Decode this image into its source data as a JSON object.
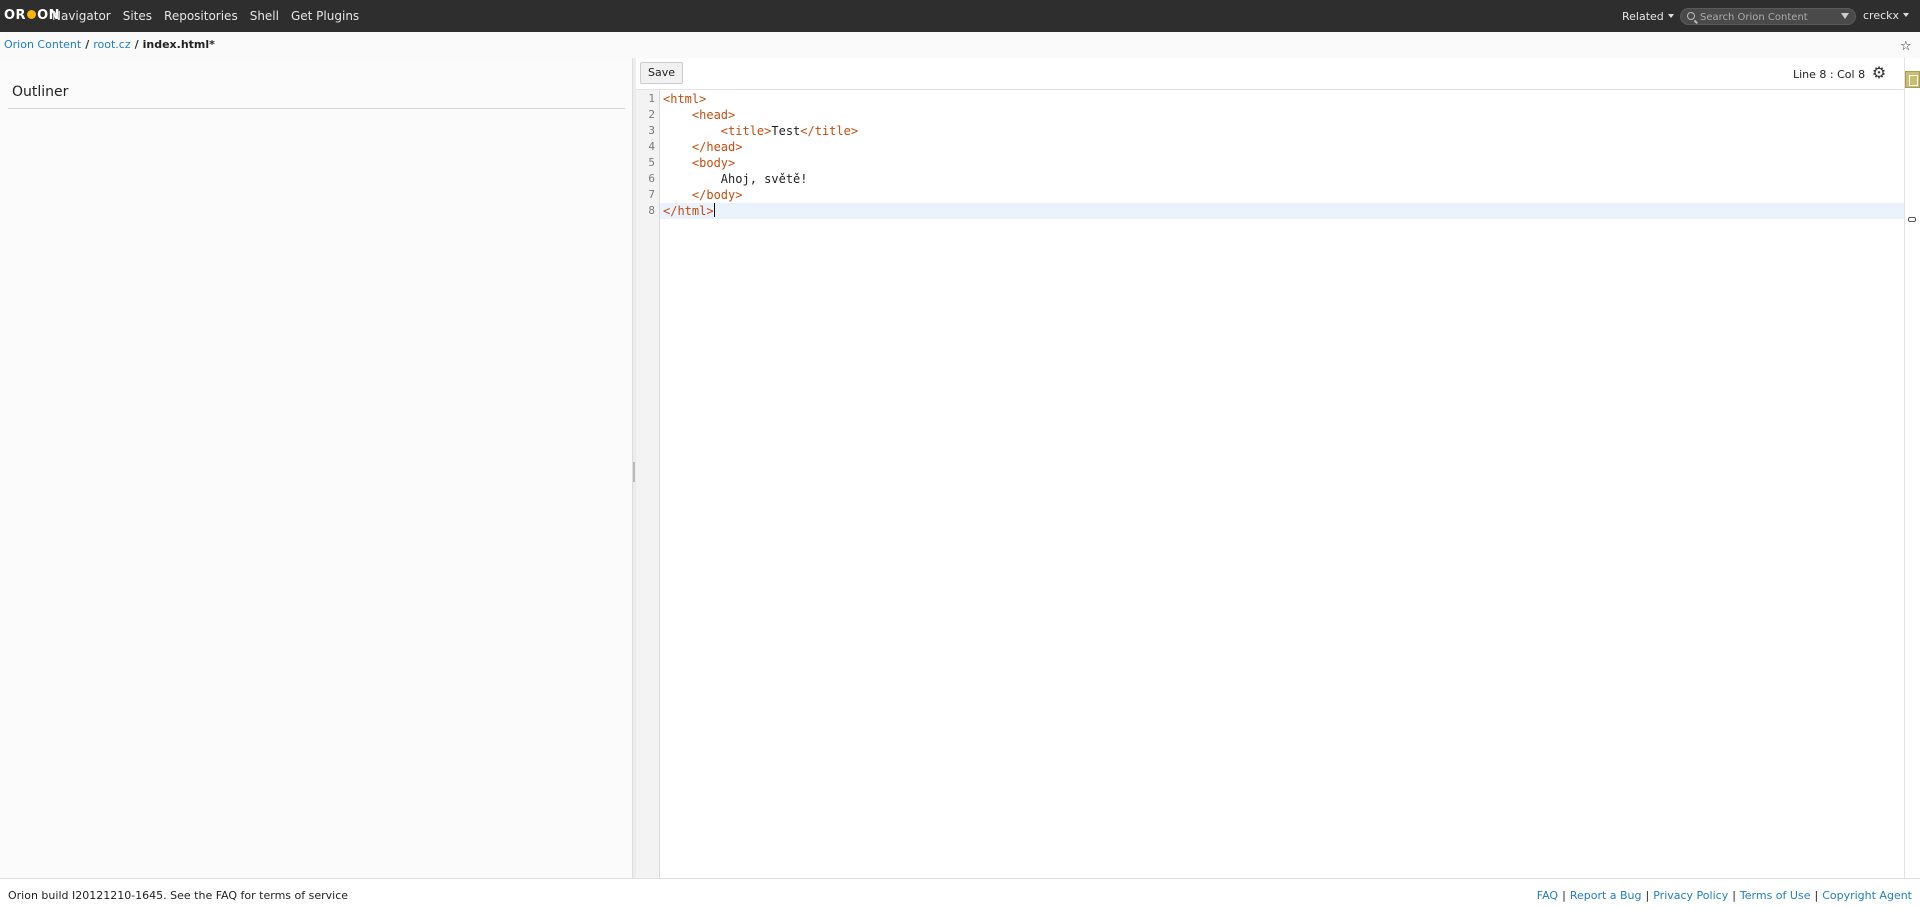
{
  "topbar": {
    "logo": {
      "pre": "OR",
      "post": "ON"
    },
    "nav": [
      "Navigator",
      "Sites",
      "Repositories",
      "Shell",
      "Get Plugins"
    ],
    "related_label": "Related",
    "search_placeholder": "Search Orion Content",
    "user": "creckx"
  },
  "breadcrumb": {
    "root": "Orion Content",
    "folder": "root.cz",
    "file": "index.html*",
    "separator": "/"
  },
  "outliner": {
    "title": "Outliner"
  },
  "editor": {
    "save_label": "Save",
    "status": "Line 8 : Col 8",
    "lines": [
      {
        "number": "1",
        "indent": "",
        "parts": [
          {
            "t": "tag",
            "v": "<html>"
          }
        ]
      },
      {
        "number": "2",
        "indent": "    ",
        "parts": [
          {
            "t": "tag",
            "v": "<head>"
          }
        ]
      },
      {
        "number": "3",
        "indent": "        ",
        "parts": [
          {
            "t": "tag",
            "v": "<title>"
          },
          {
            "t": "text",
            "v": "Test"
          },
          {
            "t": "tag",
            "v": "</title>"
          }
        ]
      },
      {
        "number": "4",
        "indent": "    ",
        "parts": [
          {
            "t": "tag",
            "v": "</head>"
          }
        ]
      },
      {
        "number": "5",
        "indent": "    ",
        "parts": [
          {
            "t": "tag",
            "v": "<body>"
          }
        ]
      },
      {
        "number": "6",
        "indent": "        ",
        "parts": [
          {
            "t": "text",
            "v": "Ahoj, světě!"
          }
        ]
      },
      {
        "number": "7",
        "indent": "    ",
        "parts": [
          {
            "t": "tag",
            "v": "</body>"
          }
        ]
      },
      {
        "number": "8",
        "indent": "",
        "parts": [
          {
            "t": "tag",
            "v": "</html>"
          }
        ],
        "active": true
      }
    ]
  },
  "footer": {
    "build_text": "Orion build I20121210-1645. See the FAQ for terms of service",
    "links": [
      "FAQ",
      "Report a Bug",
      "Privacy Policy",
      "Terms of Use",
      "Copyright Agent"
    ]
  },
  "colors": {
    "topbar": "#2e2e2e",
    "link": "#1f7fc1",
    "tag": "#c44d0f",
    "active_line": "#eaf2fd"
  },
  "icons": {
    "star": "star-icon",
    "gear": "gear-icon",
    "search": "search-icon",
    "agent": "agent-icon"
  }
}
